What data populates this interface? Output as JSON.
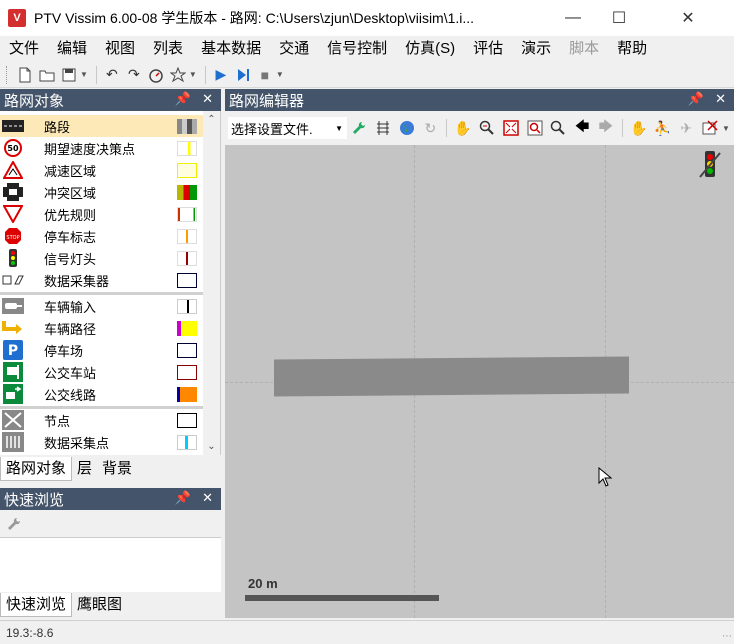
{
  "window": {
    "title": "PTV Vissim 6.00-08 学生版本 - 路网: C:\\Users\\zjun\\Desktop\\viisim\\1.i...",
    "icon": "vissim-logo-icon"
  },
  "menu": {
    "items": [
      {
        "label": "文件",
        "disabled": false
      },
      {
        "label": "编辑",
        "disabled": false
      },
      {
        "label": "视图",
        "disabled": false
      },
      {
        "label": "列表",
        "disabled": false
      },
      {
        "label": "基本数据",
        "disabled": false
      },
      {
        "label": "交通",
        "disabled": false
      },
      {
        "label": "信号控制",
        "disabled": false
      },
      {
        "label": "仿真(S)",
        "disabled": false
      },
      {
        "label": "评估",
        "disabled": false
      },
      {
        "label": "演示",
        "disabled": false
      },
      {
        "label": "脚本",
        "disabled": true
      },
      {
        "label": "帮助",
        "disabled": false
      }
    ]
  },
  "network_objects": {
    "title": "路网对象",
    "items": [
      {
        "label": "路段",
        "icon": "link-icon",
        "selected": true
      },
      {
        "label": "期望速度决策点",
        "icon": "speed-50-icon",
        "selected": false
      },
      {
        "label": "减速区域",
        "icon": "reduced-speed-icon",
        "selected": false
      },
      {
        "label": "冲突区域",
        "icon": "conflict-area-icon",
        "selected": false
      },
      {
        "label": "优先规则",
        "icon": "yield-sign-icon",
        "selected": false
      },
      {
        "label": "停车标志",
        "icon": "stop-sign-icon",
        "selected": false
      },
      {
        "label": "信号灯头",
        "icon": "signal-head-icon",
        "selected": false
      },
      {
        "label": "数据采集器",
        "icon": "data-collector-icon",
        "selected": false
      },
      {
        "label": "车辆输入",
        "icon": "vehicle-input-icon",
        "selected": false
      },
      {
        "label": "车辆路径",
        "icon": "vehicle-route-icon",
        "selected": false
      },
      {
        "label": "停车场",
        "icon": "parking-icon",
        "selected": false
      },
      {
        "label": "公交车站",
        "icon": "bus-stop-icon",
        "selected": false
      },
      {
        "label": "公交线路",
        "icon": "bus-line-icon",
        "selected": false
      },
      {
        "label": "节点",
        "icon": "node-icon",
        "selected": false
      },
      {
        "label": "数据采集点",
        "icon": "data-point-icon",
        "selected": false
      }
    ],
    "tabs": [
      "路网对象",
      "层",
      "背景"
    ]
  },
  "quick_view": {
    "title": "快速浏览",
    "tabs": [
      "快速浏览",
      "鹰眼图"
    ]
  },
  "editor": {
    "title": "路网编辑器",
    "layout_select": "选择设置文件."
  },
  "canvas": {
    "scale_label": "20 m"
  },
  "status": {
    "coords": "19.3:-8.6"
  },
  "colors": {
    "panel_header": "#44546a",
    "selected_row": "#fde8b8",
    "canvas_bg": "#c4c4c4",
    "link_fill": "#8a8a8a"
  }
}
